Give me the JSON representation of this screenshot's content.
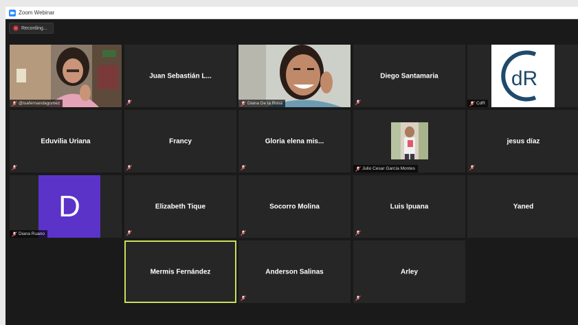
{
  "window": {
    "title": "Zoom Webinar",
    "recording_label": "Recording..."
  },
  "participants": [
    {
      "display": "@isafernandagomez",
      "type": "video"
    },
    {
      "display": "Juan Sebastián L...",
      "type": "name"
    },
    {
      "display": "Diana De la Rosa",
      "type": "video"
    },
    {
      "display": "Diego Santamaria",
      "type": "name"
    },
    {
      "display": "CdR",
      "type": "logo",
      "logo_text": "dR"
    },
    {
      "display": "Eduvilia Uriana",
      "type": "name"
    },
    {
      "display": "Francy",
      "type": "name"
    },
    {
      "display": "Gloria elena mis...",
      "type": "name"
    },
    {
      "display": "Julio Cesar García Montes",
      "type": "photo"
    },
    {
      "display": "jesus díaz",
      "type": "name"
    },
    {
      "display": "Diana Ruano",
      "type": "avatar",
      "initial": "D"
    },
    {
      "display": "Elizabeth Tique",
      "type": "name"
    },
    {
      "display": "Socorro Molina",
      "type": "name"
    },
    {
      "display": "Luis Ipuana",
      "type": "name"
    },
    {
      "display": "Yaned",
      "type": "name"
    },
    {
      "display": "Mermis Fernández",
      "type": "name",
      "active": true
    },
    {
      "display": "Anderson Salinas",
      "type": "name"
    },
    {
      "display": "Arley",
      "type": "name"
    }
  ],
  "colors": {
    "active_speaker_border": "#c8e05a",
    "avatar_purple": "#5b33c8",
    "recording_dot": "#e0484e",
    "muted_icon": "#e0484e"
  },
  "icons": [
    "zoom-logo-icon",
    "recording-dot-icon",
    "muted-mic-icon"
  ]
}
